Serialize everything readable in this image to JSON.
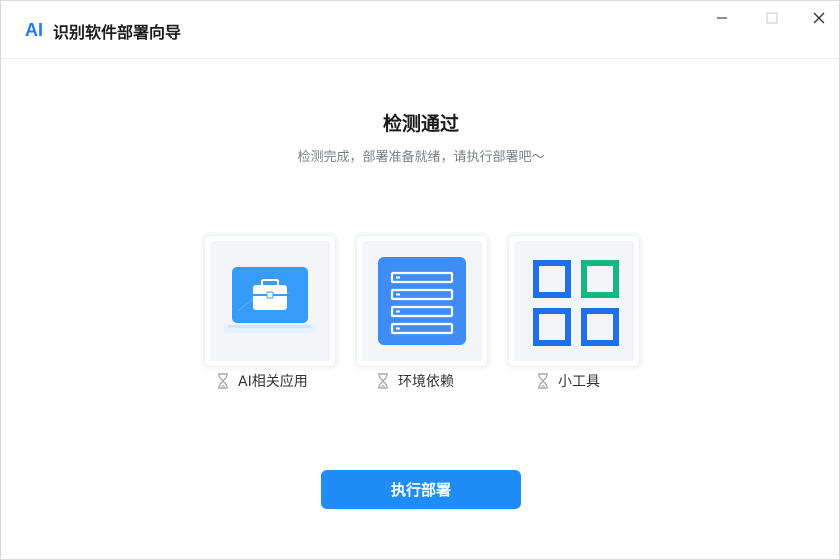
{
  "window": {
    "logo_text": "AI",
    "title": "识别软件部署向导"
  },
  "status": {
    "headline": "检测通过",
    "subline": "检测完成，部署准备就绪，请执行部署吧～"
  },
  "cards": [
    {
      "label": "AI相关应用",
      "icon": "ai-apps-laptop-icon",
      "status_icon": "hourglass-icon"
    },
    {
      "label": "环境依赖",
      "icon": "environment-list-icon",
      "status_icon": "hourglass-icon"
    },
    {
      "label": "小工具",
      "icon": "tools-grid-icon",
      "status_icon": "hourglass-icon"
    }
  ],
  "actions": {
    "deploy_label": "执行部署"
  },
  "colors": {
    "accent": "#1f8cf8",
    "logo": "#1f7cf5",
    "tools_green": "#16b67f",
    "tools_blue": "#1f6fe6"
  }
}
